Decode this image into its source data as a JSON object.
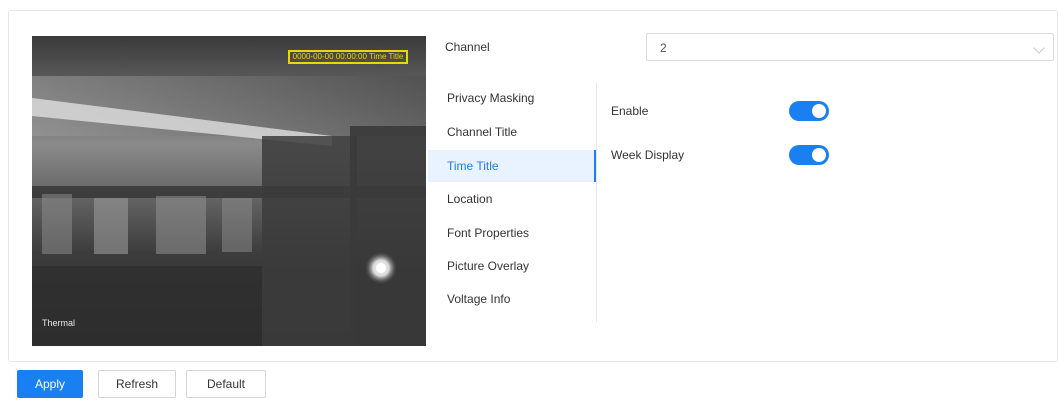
{
  "preview": {
    "osd_time_title": "0000-00-00 00:00:00 Time Title",
    "osd_channel_tag": "Thermal"
  },
  "channel": {
    "label": "Channel",
    "value": "2"
  },
  "menu": {
    "items": [
      {
        "label": "Privacy Masking"
      },
      {
        "label": "Channel Title"
      },
      {
        "label": "Time Title"
      },
      {
        "label": "Location"
      },
      {
        "label": "Font Properties"
      },
      {
        "label": "Picture Overlay"
      },
      {
        "label": "Voltage Info"
      }
    ],
    "active": "Time Title"
  },
  "options": {
    "enable": {
      "label": "Enable",
      "on": true
    },
    "week_display": {
      "label": "Week Display",
      "on": true
    }
  },
  "buttons": {
    "apply": "Apply",
    "refresh": "Refresh",
    "default": "Default"
  },
  "colors": {
    "accent": "#1a7ff0",
    "osd_box": "#e6d800"
  }
}
